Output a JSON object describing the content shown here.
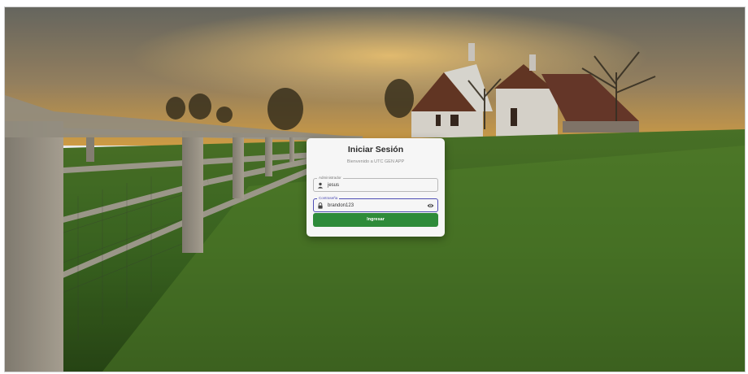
{
  "login": {
    "title": "Iniciar Sesión",
    "subtitle": "Bienvenido a UTC GEN APP",
    "username": {
      "label": "Administrador",
      "value": "jesus",
      "icon": "person-icon"
    },
    "password": {
      "label": "Contraseña",
      "value": "brandon123",
      "icon": "lock-icon",
      "toggle_icon": "eye-icon"
    },
    "submit_label": "Ingresar"
  },
  "colors": {
    "button": "#2e8b3a",
    "focus": "#4f4fb5"
  },
  "background": {
    "description_icon": "farm-landscape-background"
  }
}
